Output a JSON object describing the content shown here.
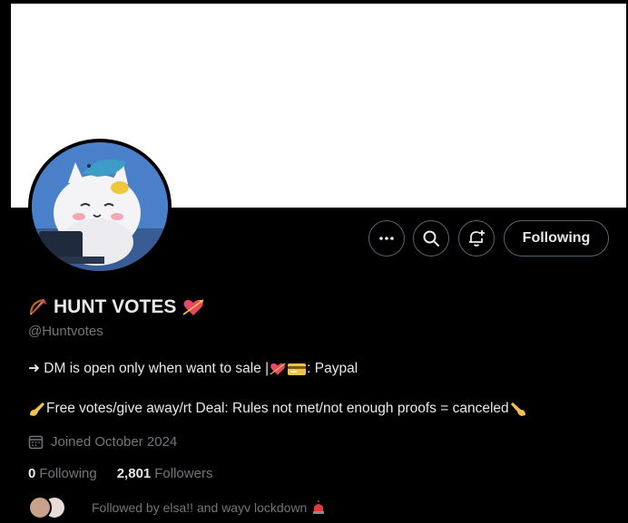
{
  "profile": {
    "display_name": "HUNT VOTES",
    "handle": "@Huntvotes",
    "bio_line1_a": "➜ DM is open only when want to sale | ",
    "bio_line1_b": ": Paypal",
    "bio_line2": "Free votes/give away/rt Deal: Rules not met/not enough proofs = canceled",
    "joined": "Joined October 2024",
    "following_count": "0",
    "following_label": "Following",
    "followers_count": "2,801",
    "followers_label": "Followers",
    "followed_by": "Followed by elsa!! and wayv lockdown"
  },
  "actions": {
    "following_button": "Following"
  },
  "icons": {
    "more": "more-icon",
    "search": "search-icon",
    "notify": "notification-bell-plus-icon",
    "calendar": "calendar-icon",
    "name_left": "bow-and-arrow-emoji",
    "name_right": "heart-with-arrow-emoji",
    "bio_heart": "heart-with-arrow-emoji",
    "bio_card": "credit-card-emoji",
    "bio_left": "right-hand-pointing-emoji",
    "bio_right": "left-hand-pointing-emoji",
    "siren": "police-light-emoji"
  },
  "colors": {
    "background": "#000000",
    "text_primary": "#e7e9ea",
    "text_secondary": "#71767b",
    "border": "#536471"
  }
}
